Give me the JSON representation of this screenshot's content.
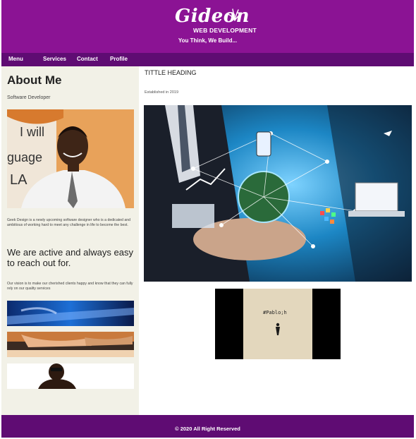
{
  "header": {
    "logo_script": "Gideon",
    "logo_sub": "WEB DEVELOPMENT",
    "tagline": "You Think, We Build...",
    "bg_color": "#8b1394"
  },
  "nav": {
    "items": [
      {
        "label": "Menu"
      },
      {
        "label": "Services"
      },
      {
        "label": "Contact"
      },
      {
        "label": "Profile"
      }
    ],
    "bg_color": "#5f0c73"
  },
  "sidebar": {
    "title": "About Me",
    "subtitle": "Software Developer",
    "about_text": "Geek Design is a newly upcoming software designer who is a dedicated and ambitious of working hard to meet any challenge in life to become the best.",
    "active_text": "We are active and always easy to reach out for.",
    "vision_text": "Our vision is to make our cherished clients happy and know that they can fully rely on our quality services",
    "bg_color": "#f2f1e7"
  },
  "main": {
    "heading": "TITTLE HEADING",
    "established": "Established in 2019",
    "video_label": "#Pablo;h"
  },
  "footer": {
    "text": "© 2020 All Right Reserved"
  }
}
